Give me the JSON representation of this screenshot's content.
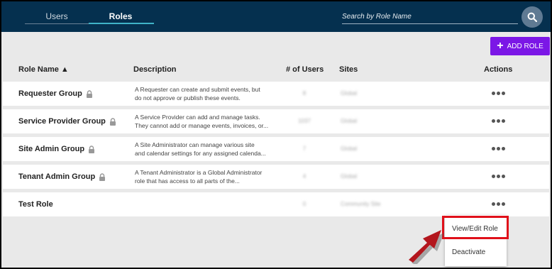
{
  "tabs": [
    {
      "label": "Users",
      "active": false
    },
    {
      "label": "Roles",
      "active": true
    }
  ],
  "search": {
    "placeholder": "Search by Role Name"
  },
  "toolbar": {
    "add_role_label": "ADD ROLE"
  },
  "table": {
    "headers": {
      "role_name": "Role Name ▲",
      "description": "Description",
      "users": "# of Users",
      "sites": "Sites",
      "actions": "Actions"
    },
    "rows": [
      {
        "name": "Requester Group",
        "locked": true,
        "desc1": "A Requester can create and submit events, but",
        "desc2": "do not approve or publish these events.",
        "users": "8",
        "sites": "Global"
      },
      {
        "name": "Service Provider Group",
        "locked": true,
        "desc1": "A Service Provider can add and manage tasks.",
        "desc2": "They cannot add or manage events, invoices, or...",
        "users": "1037",
        "sites": "Global"
      },
      {
        "name": "Site Admin Group",
        "locked": true,
        "desc1": "A Site Administrator can manage various site",
        "desc2": "and calendar settings for any assigned calenda...",
        "users": "7",
        "sites": "Global"
      },
      {
        "name": "Tenant Admin Group",
        "locked": true,
        "desc1": "A Tenant Administrator is a Global Administrator",
        "desc2": "role that has access to all parts of the...",
        "users": "4",
        "sites": "Global"
      },
      {
        "name": "Test Role",
        "locked": false,
        "desc1": "",
        "desc2": "",
        "users": "0",
        "sites": "Community Site"
      }
    ]
  },
  "context_menu": {
    "items": [
      "View/Edit Role",
      "Deactivate"
    ],
    "highlighted": "View/Edit Role"
  },
  "colors": {
    "header_bg": "#05304f",
    "accent_tab": "#3fb3c8",
    "add_button": "#7b17e6",
    "highlight_box": "#e0101a",
    "arrow": "#b3161d"
  },
  "icons": {
    "search": "search-icon",
    "lock": "lock-icon",
    "more": "more-dots-icon",
    "plus": "plus-icon"
  }
}
